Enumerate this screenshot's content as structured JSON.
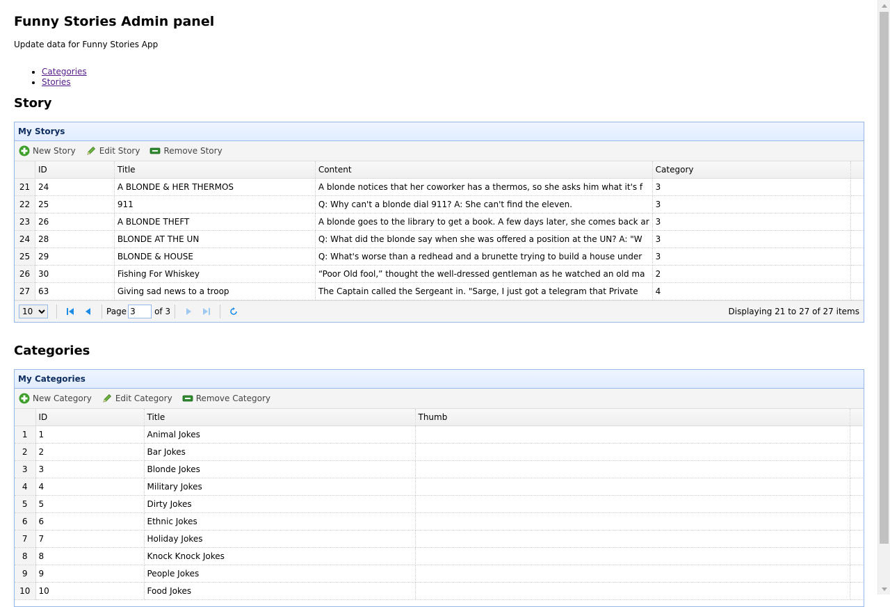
{
  "app": {
    "title": "Funny Stories Admin panel",
    "subtitle": "Update data for Funny Stories App"
  },
  "nav": [
    {
      "label": "Categories"
    },
    {
      "label": "Stories"
    }
  ],
  "story_section": {
    "heading": "Story",
    "panel_title": "My Storys",
    "toolbar": {
      "new_label": "New Story",
      "edit_label": "Edit Story",
      "remove_label": "Remove Story"
    },
    "columns": [
      "ID",
      "Title",
      "Content",
      "Category"
    ],
    "rows": [
      {
        "rownum": "21",
        "id": "24",
        "title": "A BLONDE & HER THERMOS",
        "content": "A blonde notices that her coworker has a thermos, so she asks him what it's f",
        "category": "3"
      },
      {
        "rownum": "22",
        "id": "25",
        "title": "911",
        "content": "Q: Why can't a blonde dial 911? A: She can't find the eleven.",
        "category": "3"
      },
      {
        "rownum": "23",
        "id": "26",
        "title": "A BLONDE THEFT",
        "content": "A blonde goes to the library to get a book. A few days later, she comes back ar",
        "category": "3"
      },
      {
        "rownum": "24",
        "id": "28",
        "title": "BLONDE AT THE UN",
        "content": "Q: What did the blonde say when she was offered a position at the UN? A: \"W",
        "category": "3"
      },
      {
        "rownum": "25",
        "id": "29",
        "title": "BLONDE & HOUSE",
        "content": "Q: What's worse than a redhead and a brunette trying to build a house under",
        "category": "3"
      },
      {
        "rownum": "26",
        "id": "30",
        "title": "Fishing For Whiskey",
        "content": "“Poor Old fool,” thought the well-dressed gentleman as he watched an old ma",
        "category": "2"
      },
      {
        "rownum": "27",
        "id": "63",
        "title": "Giving sad news to a troop",
        "content": "The Captain called the Sergeant in. \"Sarge, I just got a telegram that Private",
        "category": "4"
      }
    ],
    "pager": {
      "page_size": "10",
      "page_label": "Page",
      "current_page": "3",
      "of_label": "of 3",
      "display_info": "Displaying 21 to 27 of 27 items"
    }
  },
  "category_section": {
    "heading": "Categories",
    "panel_title": "My Categories",
    "toolbar": {
      "new_label": "New Category",
      "edit_label": "Edit Category",
      "remove_label": "Remove Category"
    },
    "columns": [
      "ID",
      "Title",
      "Thumb"
    ],
    "rows": [
      {
        "rownum": "1",
        "id": "1",
        "title": "Animal Jokes",
        "thumb": ""
      },
      {
        "rownum": "2",
        "id": "2",
        "title": "Bar Jokes",
        "thumb": ""
      },
      {
        "rownum": "3",
        "id": "3",
        "title": "Blonde Jokes",
        "thumb": ""
      },
      {
        "rownum": "4",
        "id": "4",
        "title": "Military Jokes",
        "thumb": ""
      },
      {
        "rownum": "5",
        "id": "5",
        "title": "Dirty Jokes",
        "thumb": ""
      },
      {
        "rownum": "6",
        "id": "6",
        "title": "Ethnic Jokes",
        "thumb": ""
      },
      {
        "rownum": "7",
        "id": "7",
        "title": "Holiday Jokes",
        "thumb": ""
      },
      {
        "rownum": "8",
        "id": "8",
        "title": "Knock Knock Jokes",
        "thumb": ""
      },
      {
        "rownum": "9",
        "id": "9",
        "title": "People Jokes",
        "thumb": ""
      },
      {
        "rownum": "10",
        "id": "10",
        "title": "Food Jokes",
        "thumb": ""
      }
    ]
  },
  "icons": {
    "new": "plus-icon",
    "edit": "pencil-icon",
    "remove": "minus-icon",
    "first": "first-page-icon",
    "prev": "prev-page-icon",
    "next": "next-page-icon",
    "last": "last-page-icon",
    "refresh": "refresh-icon"
  },
  "colors": {
    "panel_border": "#95b8e7",
    "panel_header": "#e0ecff",
    "panel_title_text": "#0e2d5f",
    "pager_icon": "#1c8ce6",
    "pager_icon_disabled": "#9fc9ee",
    "add_icon": "#3c9f29"
  }
}
